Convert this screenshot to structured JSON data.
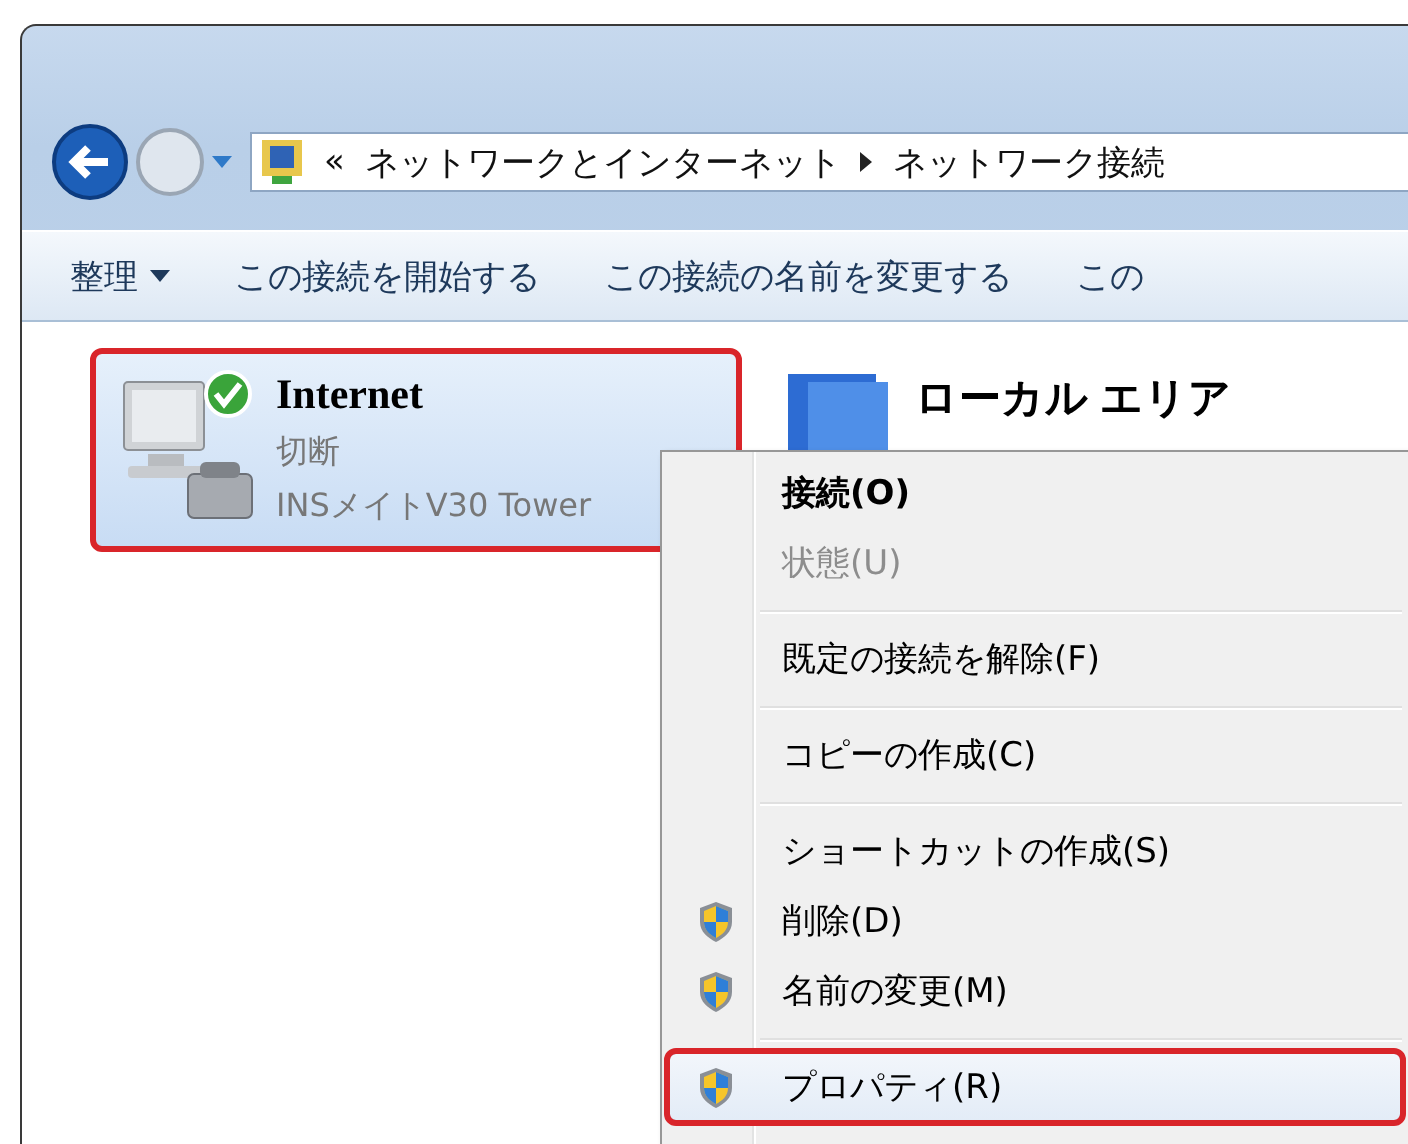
{
  "address_bar": {
    "overflow": "«",
    "crumbs": [
      "ネットワークとインターネット",
      "ネットワーク接続"
    ]
  },
  "toolbar": {
    "items": [
      {
        "label": "整理",
        "dropdown": true
      },
      {
        "label": "この接続を開始する",
        "dropdown": false
      },
      {
        "label": "この接続の名前を変更する",
        "dropdown": false
      },
      {
        "label": "この",
        "dropdown": false
      }
    ]
  },
  "connections": [
    {
      "name": "Internet",
      "status": "切断",
      "device": "INSメイトV30 Tower",
      "selected": true,
      "circled": true,
      "kind": "dialup"
    },
    {
      "name": "ローカル エリア",
      "selected": false,
      "kind": "lan"
    }
  ],
  "context_menu": {
    "items": [
      {
        "kind": "item",
        "label": "接続(O)",
        "default": true,
        "disabled": false,
        "selected": false
      },
      {
        "kind": "item",
        "label": "状態(U)",
        "default": false,
        "disabled": true,
        "selected": false
      },
      {
        "kind": "separator"
      },
      {
        "kind": "item",
        "label": "既定の接続を解除(F)",
        "default": false,
        "disabled": false,
        "selected": false
      },
      {
        "kind": "separator"
      },
      {
        "kind": "item",
        "label": "コピーの作成(C)",
        "default": false,
        "disabled": false,
        "selected": false
      },
      {
        "kind": "separator"
      },
      {
        "kind": "item",
        "label": "ショートカットの作成(S)",
        "default": false,
        "disabled": false,
        "selected": false
      },
      {
        "kind": "item",
        "label": "削除(D)",
        "default": false,
        "disabled": false,
        "shield": true,
        "selected": false
      },
      {
        "kind": "item",
        "label": "名前の変更(M)",
        "default": false,
        "disabled": false,
        "shield": true,
        "selected": false
      },
      {
        "kind": "separator"
      },
      {
        "kind": "item",
        "label": "プロパティ(R)",
        "default": false,
        "disabled": false,
        "shield": true,
        "selected": true,
        "circled": true
      }
    ]
  }
}
